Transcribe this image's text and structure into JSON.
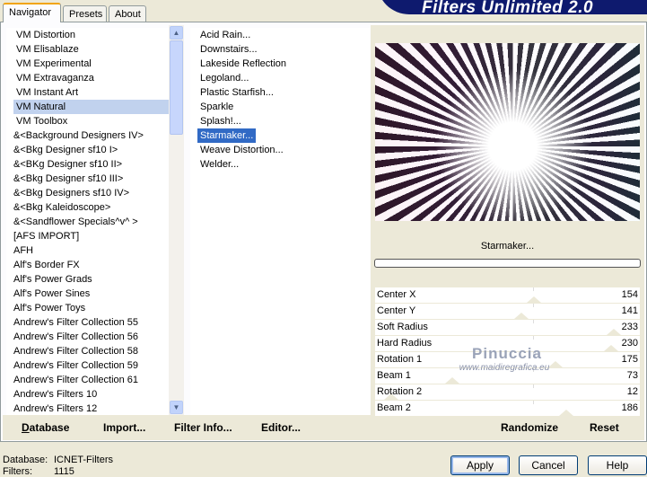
{
  "tabs": [
    "Navigator",
    "Presets",
    "About"
  ],
  "banner": "Filters Unlimited 2.0",
  "categories": [
    "VM Distortion",
    "VM Elisablaze",
    "VM Experimental",
    "VM Extravaganza",
    "VM Instant Art",
    "VM Natural",
    "VM Toolbox",
    "&<Background Designers IV>",
    "&<Bkg Designer sf10 I>",
    "&<BKg Designer sf10 II>",
    "&<Bkg Designer sf10 III>",
    "&<Bkg Designers sf10 IV>",
    "&<Bkg Kaleidoscope>",
    "&<Sandflower Specials^v^ >",
    "[AFS IMPORT]",
    "AFH",
    "Alf's Border FX",
    "Alf's Power Grads",
    "Alf's Power Sines",
    "Alf's Power Toys",
    "Andrew's Filter Collection 55",
    "Andrew's Filter Collection 56",
    "Andrew's Filter Collection 58",
    "Andrew's Filter Collection 59",
    "Andrew's Filter Collection 61",
    "Andrew's Filters 10",
    "Andrew's Filters 12"
  ],
  "selected_category": "VM Natural",
  "filters": [
    "Acid Rain...",
    "Downstairs...",
    "Lakeside Reflection",
    "Legoland...",
    "Plastic Starfish...",
    "Sparkle",
    "Splash!...",
    "Starmaker...",
    "Weave Distortion...",
    "Welder..."
  ],
  "selected_filter": "Starmaker...",
  "filter_title": "Starmaker...",
  "progress": 0,
  "params": [
    {
      "label": "Center X",
      "value": 154
    },
    {
      "label": "Center Y",
      "value": 141
    },
    {
      "label": "Soft Radius",
      "value": 233
    },
    {
      "label": "Hard Radius",
      "value": 230
    },
    {
      "label": "Rotation 1",
      "value": 175
    },
    {
      "label": "Beam 1",
      "value": 73
    },
    {
      "label": "Rotation 2",
      "value": 12
    },
    {
      "label": "Beam 2",
      "value": 186
    }
  ],
  "param_max": 255,
  "watermark": {
    "name": "Pinuccia",
    "url": "www.maidiregrafica.eu"
  },
  "bottom_buttons": {
    "database": "Database",
    "import": "Import...",
    "filter_info": "Filter Info...",
    "editor": "Editor...",
    "randomize": "Randomize",
    "reset": "Reset"
  },
  "status": {
    "database_label": "Database:",
    "database_value": "ICNET-Filters",
    "filters_label": "Filters:",
    "filters_value": "1115"
  },
  "dialog_buttons": {
    "apply": "Apply",
    "cancel": "Cancel",
    "help": "Help"
  }
}
